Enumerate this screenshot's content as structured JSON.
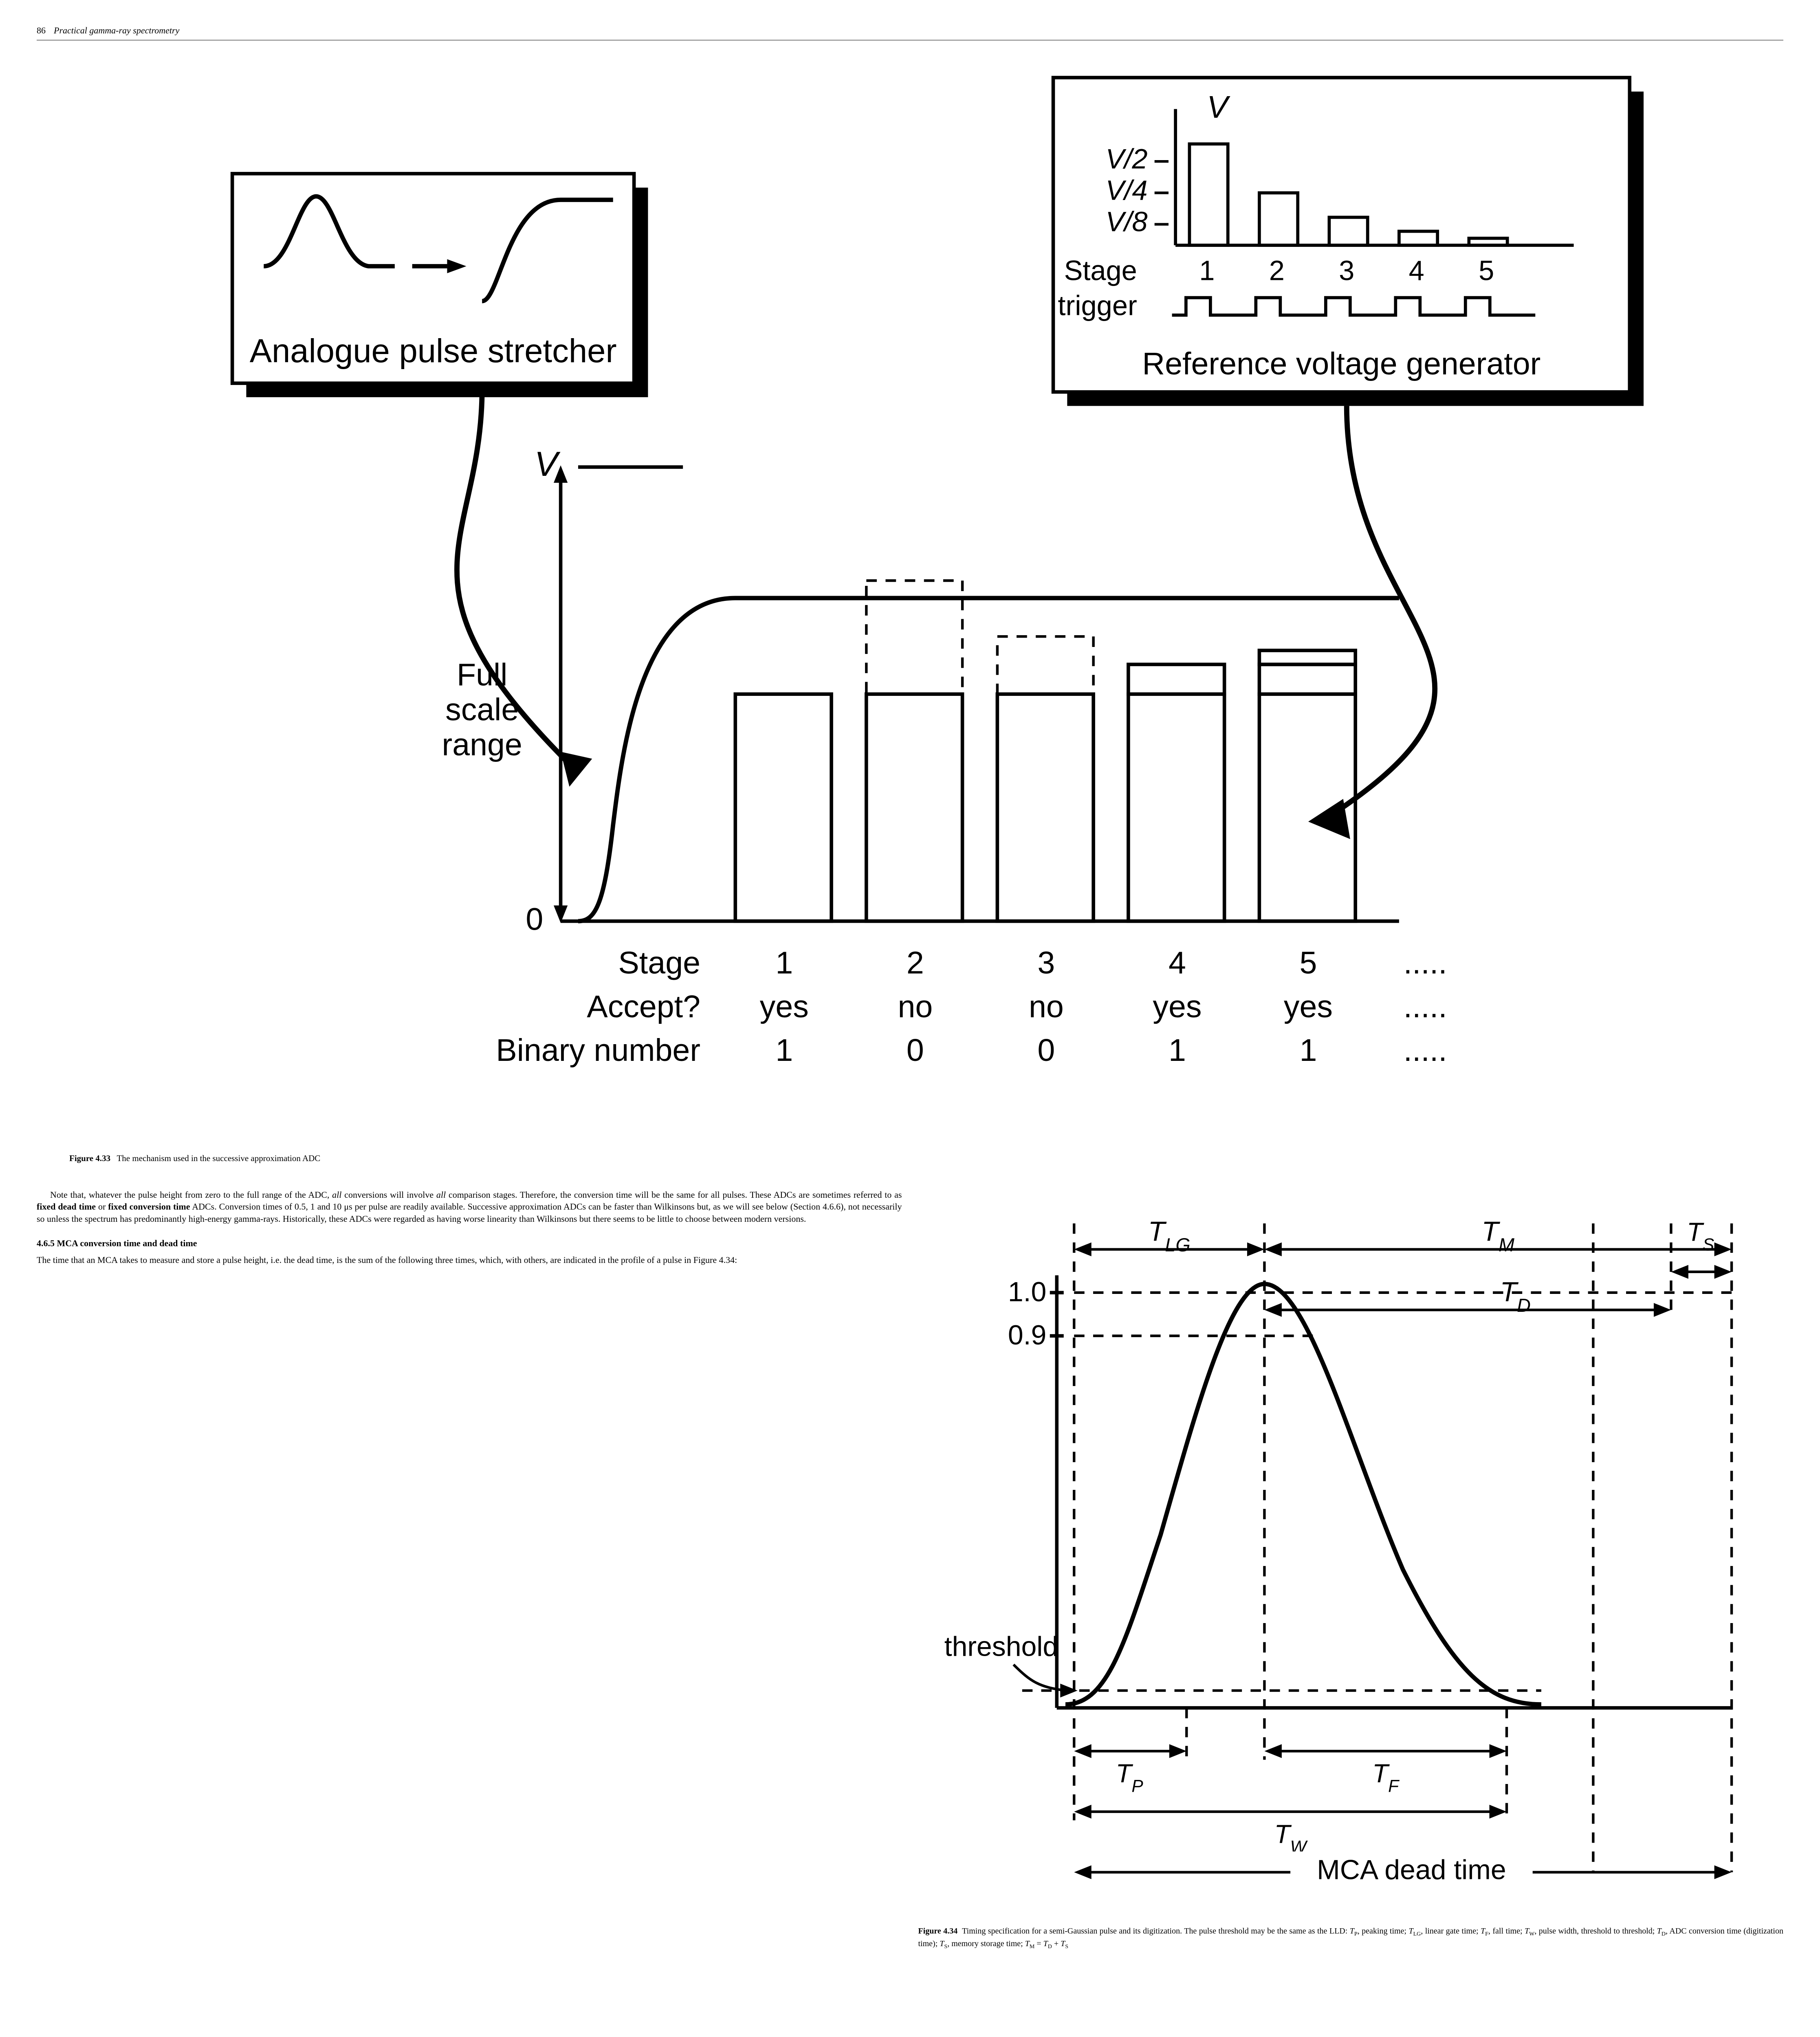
{
  "header": {
    "page_number": "86",
    "running_title": "Practical gamma-ray spectrometry"
  },
  "figure33": {
    "box_left": "Analogue pulse stretcher",
    "box_right_title": "Reference voltage generator",
    "rvg": {
      "V": "V",
      "V2": "V/2",
      "V4": "V/4",
      "V8": "V/8",
      "stage_label": "Stage",
      "trigger_label": "trigger",
      "stages": [
        "1",
        "2",
        "3",
        "4",
        "5"
      ]
    },
    "main": {
      "V": "V",
      "full_scale": "Full\nscale\nrange",
      "zero": "0",
      "row_stage_label": "Stage",
      "row_accept_label": "Accept?",
      "row_binary_label": "Binary number",
      "stages": [
        "1",
        "2",
        "3",
        "4",
        "5",
        "....."
      ],
      "accept": [
        "yes",
        "no",
        "no",
        "yes",
        "yes",
        "....."
      ],
      "binary": [
        "1",
        "0",
        "0",
        "1",
        "1",
        "....."
      ]
    },
    "caption_num": "Figure 4.33",
    "caption_text": "The mechanism used in the successive approximation ADC"
  },
  "paragraph1": "Note that, whatever the pulse height from zero to the full range of the ADC, all conversions will involve all comparison stages. Therefore, the conversion time will be the same for all pulses. These ADCs are sometimes referred to as fixed dead time or fixed conversion time ADCs. Conversion times of 0.5, 1 and 10 μs per pulse are readily available. Successive approximation ADCs can be faster than Wilkinsons but, as we will see below (Section 4.6.6), not necessarily so unless the spectrum has predominantly high-energy gamma-rays. Historically, these ADCs were regarded as having worse linearity than Wilkinsons but there seems to be little to choose between modern versions.",
  "section_heading": "4.6.5 MCA conversion time and dead time",
  "paragraph2": "The time that an MCA takes to measure and store a pulse height, i.e. the dead time, is the sum of the following three times, which, with others, are indicated in the profile of a pulse in Figure 4.34:",
  "figure34": {
    "threshold": "threshold",
    "y10": "1.0",
    "y09": "0.9",
    "TLG": "T_LG",
    "TM": "T_M",
    "TS": "T_S",
    "TD": "T_D",
    "TP": "T_P",
    "TF": "T_F",
    "TW": "T_W",
    "mca": "MCA dead time",
    "caption_num": "Figure 4.34",
    "caption_text": "Timing specification for a semi-Gaussian pulse and its digitization. The pulse threshold may be the same as the LLD: T_P, peaking time; T_LG, linear gate time; T_F, fall time; T_W, pulse width, threshold to threshold; T_D, ADC conversion time (digitization time); T_S, memory storage time; T_M = T_D + T_S"
  }
}
